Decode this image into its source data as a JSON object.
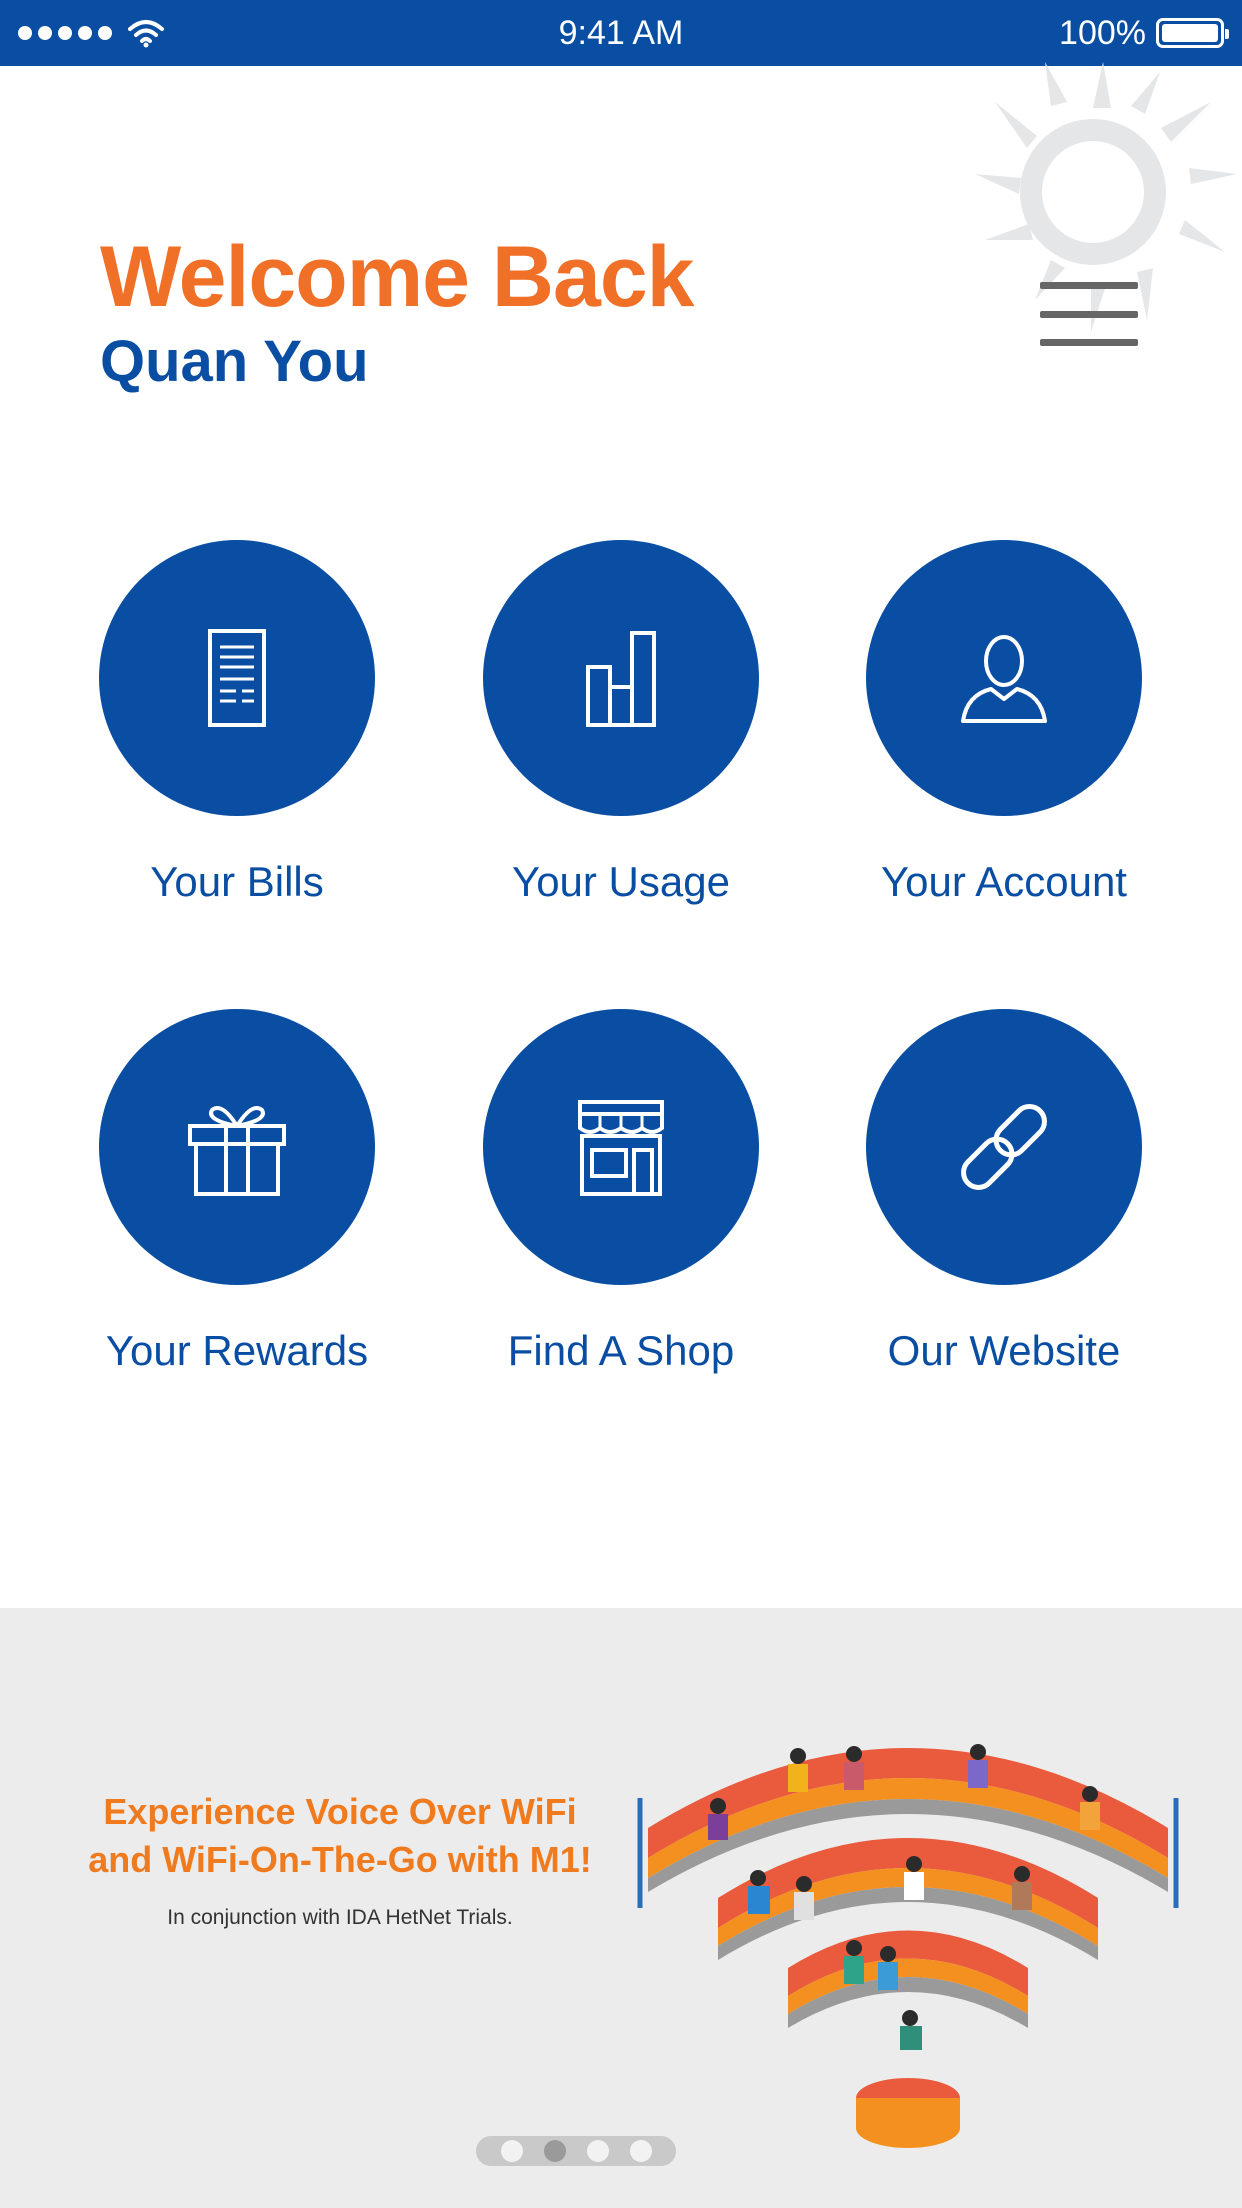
{
  "status_bar": {
    "time": "9:41 AM",
    "battery": "100%",
    "icons": [
      "signal-dots-icon",
      "wifi-icon",
      "battery-icon"
    ]
  },
  "header": {
    "welcome": "Welcome Back",
    "user_name": "Quan You",
    "menu_icon": "hamburger-menu-icon"
  },
  "tiles": [
    {
      "label": "Your Bills",
      "icon": "bill-document-icon"
    },
    {
      "label": "Your Usage",
      "icon": "bar-chart-icon"
    },
    {
      "label": "Your Account",
      "icon": "user-profile-icon"
    },
    {
      "label": "Your Rewards",
      "icon": "gift-icon"
    },
    {
      "label": "Find A Shop",
      "icon": "shop-storefront-icon"
    },
    {
      "label": "Our Website",
      "icon": "link-chain-icon"
    }
  ],
  "banner": {
    "headline_line1": "Experience Voice Over WiFi",
    "headline_line2": "and WiFi-On-The-Go with M1!",
    "subtext": "In conjunction with IDA HetNet Trials.",
    "page_count": 4,
    "active_page": 2
  },
  "colors": {
    "brand_blue": "#0a4ea3",
    "brand_orange": "#f07028",
    "banner_bg": "#ececec"
  }
}
